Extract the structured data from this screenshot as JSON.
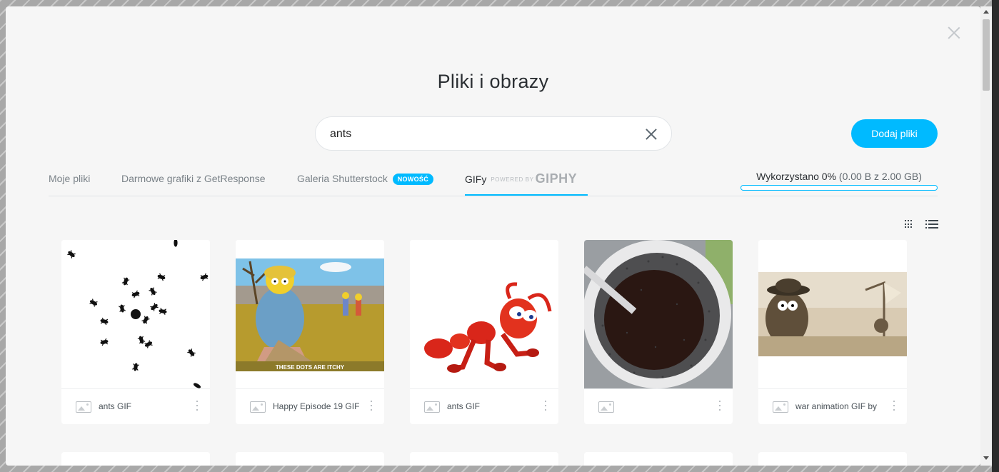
{
  "modal": {
    "title": "Pliki i obrazy",
    "close_icon": "close-icon"
  },
  "search": {
    "value": "ants",
    "placeholder": "",
    "clear_icon": "clear-icon"
  },
  "add_button_label": "Dodaj pliki",
  "tabs": [
    {
      "label": "Moje pliki",
      "active": false
    },
    {
      "label": "Darmowe grafiki z GetResponse",
      "active": false
    },
    {
      "label": "Galeria Shutterstock",
      "badge": "NOWOŚĆ",
      "active": false
    },
    {
      "label": "GIFy",
      "powered_by": "POWERED BY",
      "brand": "GIPHY",
      "active": true
    }
  ],
  "usage": {
    "label": "Wykorzystano 0%",
    "detail": "(0.00 B z 2.00 GB)",
    "percent": 0
  },
  "view_toggle": {
    "grid_icon": "grid-view-icon",
    "list_icon": "list-view-icon"
  },
  "cards": [
    {
      "label": "ants GIF",
      "thumbnail": "scattered ants"
    },
    {
      "label": "Happy Episode 19 GIF",
      "thumbnail": "cartoon character scratching",
      "caption": "THESE DOTS ARE ITCHY"
    },
    {
      "label": "ants GIF",
      "thumbnail": "red cartoon ant"
    },
    {
      "label": "",
      "thumbnail": "ants in coffee cup"
    },
    {
      "label": "war animation GIF by",
      "thumbnail": "sepia war animation"
    }
  ],
  "colors": {
    "accent": "#00baff",
    "modal_bg": "#f6f6f6",
    "text_dark": "#2b2f33",
    "text_muted": "#7a8288"
  }
}
